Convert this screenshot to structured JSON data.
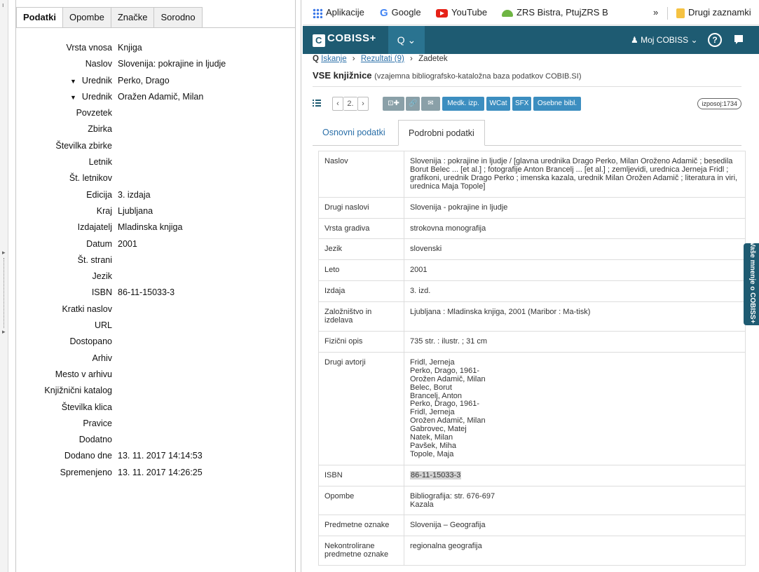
{
  "zotero": {
    "tabs": [
      "Podatki",
      "Opombe",
      "Značke",
      "Sorodno"
    ],
    "fields": [
      {
        "label": "Vrsta vnosa",
        "value": "Knjiga",
        "creator": false
      },
      {
        "label": "Naslov",
        "value": "Slovenija: pokrajine in ljudje",
        "creator": false
      },
      {
        "label": "Urednik",
        "value": "Perko, Drago",
        "creator": true
      },
      {
        "label": "Urednik",
        "value": "Oražen Adamič, Milan",
        "creator": true
      },
      {
        "label": "Povzetek",
        "value": "",
        "creator": false
      },
      {
        "label": "Zbirka",
        "value": "",
        "creator": false
      },
      {
        "label": "Številka zbirke",
        "value": "",
        "creator": false
      },
      {
        "label": "Letnik",
        "value": "",
        "creator": false
      },
      {
        "label": "Št. letnikov",
        "value": "",
        "creator": false
      },
      {
        "label": "Edicija",
        "value": "3. izdaja",
        "creator": false
      },
      {
        "label": "Kraj",
        "value": "Ljubljana",
        "creator": false
      },
      {
        "label": "Izdajatelj",
        "value": "Mladinska knjiga",
        "creator": false
      },
      {
        "label": "Datum",
        "value": "2001",
        "creator": false
      },
      {
        "label": "Št. strani",
        "value": "",
        "creator": false
      },
      {
        "label": "Jezik",
        "value": "",
        "creator": false
      },
      {
        "label": "ISBN",
        "value": "86-11-15033-3",
        "creator": false
      },
      {
        "label": "Kratki naslov",
        "value": "",
        "creator": false
      },
      {
        "label": "URL",
        "value": "",
        "creator": false
      },
      {
        "label": "Dostopano",
        "value": "",
        "creator": false
      },
      {
        "label": "Arhiv",
        "value": "",
        "creator": false
      },
      {
        "label": "Mesto v arhivu",
        "value": "",
        "creator": false
      },
      {
        "label": "Knjižnični katalog",
        "value": "",
        "creator": false
      },
      {
        "label": "Številka klica",
        "value": "",
        "creator": false
      },
      {
        "label": "Pravice",
        "value": "",
        "creator": false
      },
      {
        "label": "Dodatno",
        "value": "",
        "creator": false
      },
      {
        "label": "Dodano dne",
        "value": "13. 11. 2017 14:14:53",
        "creator": false
      },
      {
        "label": "Spremenjeno",
        "value": "13. 11. 2017 14:26:25",
        "creator": false
      }
    ]
  },
  "bookmarks": {
    "items": [
      "Aplikacije",
      "Google",
      "YouTube",
      "ZRS Bistra, PtujZRS B"
    ],
    "more": "»",
    "other": "Drugi zaznamki"
  },
  "cobiss": {
    "logo": "COBISS+",
    "search_label": "Q ⌄",
    "moj": "Moj COBISS",
    "help": "?",
    "breadcrumb": {
      "search": "Iskanje",
      "results": "Rezultati (9)",
      "current": "Zadetek"
    },
    "heading": {
      "title": "VSE knjižnice",
      "subtitle": "(vzajemna bibliografsko-kataložna baza podatkov COBIB.SI)"
    },
    "toolbar": {
      "page": "2.",
      "prev": "‹",
      "next": "›",
      "buttons": [
        "⊡✚",
        "🔗",
        "✉",
        "Medk. izp.",
        "WCat",
        "SFX",
        "Osebne bibl."
      ],
      "izposoj": "izposoj:1734"
    },
    "tabs": [
      "Osnovni podatki",
      "Podrobni podatki"
    ],
    "rows": [
      {
        "key": "Naslov",
        "value": "Slovenija : pokrajine in ljudje / [glavna urednika Drago Perko, Milan Oroženo Adamič ; besedila Borut Belec ... [et al.] ; fotografije Anton Brancelj ... [et al.] ; zemljevidi, urednica Jerneja Fridl ; grafikoni, urednik Drago Perko ; imenska kazala, urednik Milan Orožen Adamič ; literatura in viri, urednica Maja Topole]"
      },
      {
        "key": "Drugi naslovi",
        "value": "Slovenija - pokrajine in ljudje"
      },
      {
        "key": "Vrsta gradiva",
        "value": "strokovna monografija"
      },
      {
        "key": "Jezik",
        "value": "slovenski"
      },
      {
        "key": "Leto",
        "value": "2001"
      },
      {
        "key": "Izdaja",
        "value": "3. izd."
      },
      {
        "key": "Založništvo in izdelava",
        "value": "Ljubljana : Mladinska knjiga, 2001 (Maribor : Ma-tisk)"
      },
      {
        "key": "Fizični opis",
        "value": "735 str. : ilustr. ; 31 cm"
      },
      {
        "key": "Drugi avtorji",
        "value": "Fridl, Jerneja\nPerko, Drago, 1961-\nOrožen Adamič, Milan\nBelec, Borut\nBrancelj, Anton\nPerko, Drago, 1961-\nFridl, Jerneja\nOrožen Adamič, Milan\nGabrovec, Matej\nNatek, Milan\nPavšek, Miha\nTopole, Maja"
      },
      {
        "key": "ISBN",
        "value": "86-11-15033-3"
      },
      {
        "key": "Opombe",
        "value": "Bibliografija: str. 676-697\nKazala"
      },
      {
        "key": "Predmetne oznake",
        "value": "Slovenija – Geografija"
      },
      {
        "key": "Nekontrolirane predmetne oznake",
        "value": "regionalna geografija"
      }
    ],
    "feedback": "Vaše mnenje o COBISS+"
  }
}
